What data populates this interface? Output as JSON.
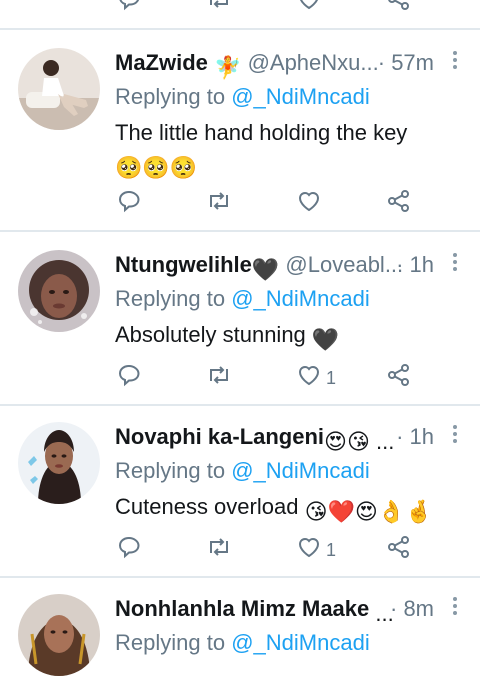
{
  "tweets": [
    {
      "name": "MaZwide",
      "name_emoji": "🧚",
      "handle": "@ApheNxu...",
      "time": "· 57m",
      "replying_label": "Replying to",
      "mention": "@_NdiMncadi",
      "text": "The little hand holding the key",
      "text_emoji": "🥺🥺🥺",
      "like_count": ""
    },
    {
      "name": "Ntungwelihle",
      "name_emoji": "🖤",
      "handle": "@Loveabl...",
      "time": "· 1h",
      "replying_label": "Replying to",
      "mention": "@_NdiMncadi",
      "text": "Absolutely stunning",
      "text_emoji": "🖤",
      "like_count": "1"
    },
    {
      "name": "Novaphi ka-Langeni",
      "name_emoji": "😍😘 ...",
      "handle": "",
      "time": "· 1h",
      "replying_label": "Replying to",
      "mention": "@_NdiMncadi",
      "text": "Cuteness overload",
      "text_emoji": "😘❤️😍👌🤞",
      "like_count": "1"
    },
    {
      "name": "Nonhlanhla Mimz Maake",
      "name_emoji": "...",
      "handle": "",
      "time": "· 8m",
      "replying_label": "Replying to",
      "mention": "@_NdiMncadi",
      "text": "",
      "text_emoji": "",
      "like_count": ""
    }
  ],
  "colors": {
    "action_gray": "#657786",
    "mention_blue": "#1da1f2",
    "divider": "#e1e8ed"
  }
}
